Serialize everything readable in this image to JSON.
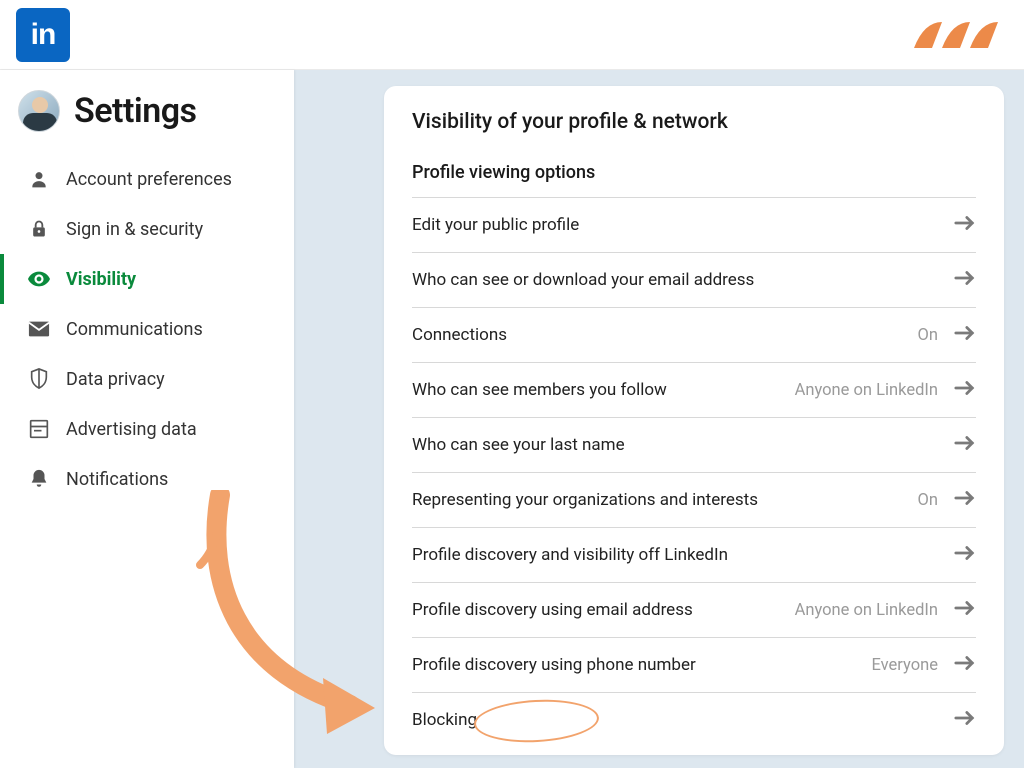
{
  "logo_text": "in",
  "sidebar": {
    "title": "Settings",
    "items": [
      {
        "icon": "user-icon",
        "label": "Account preferences"
      },
      {
        "icon": "lock-icon",
        "label": "Sign in & security"
      },
      {
        "icon": "eye-icon",
        "label": "Visibility",
        "active": true
      },
      {
        "icon": "mail-icon",
        "label": "Communications"
      },
      {
        "icon": "shield-icon",
        "label": "Data privacy"
      },
      {
        "icon": "ad-icon",
        "label": "Advertising data"
      },
      {
        "icon": "bell-icon",
        "label": "Notifications"
      }
    ]
  },
  "panel": {
    "title": "Visibility of your profile & network",
    "section_heading": "Profile viewing options",
    "rows": [
      {
        "label": "Edit your public profile",
        "value": ""
      },
      {
        "label": "Who can see or download your email address",
        "value": ""
      },
      {
        "label": "Connections",
        "value": "On"
      },
      {
        "label": "Who can see members you follow",
        "value": "Anyone on LinkedIn"
      },
      {
        "label": "Who can see your last name",
        "value": ""
      },
      {
        "label": "Representing your organizations and interests",
        "value": "On"
      },
      {
        "label": "Profile discovery and visibility off LinkedIn",
        "value": ""
      },
      {
        "label": "Profile discovery using email address",
        "value": "Anyone on LinkedIn"
      },
      {
        "label": "Profile discovery using phone number",
        "value": "Everyone"
      },
      {
        "label": "Blocking",
        "value": ""
      }
    ]
  }
}
